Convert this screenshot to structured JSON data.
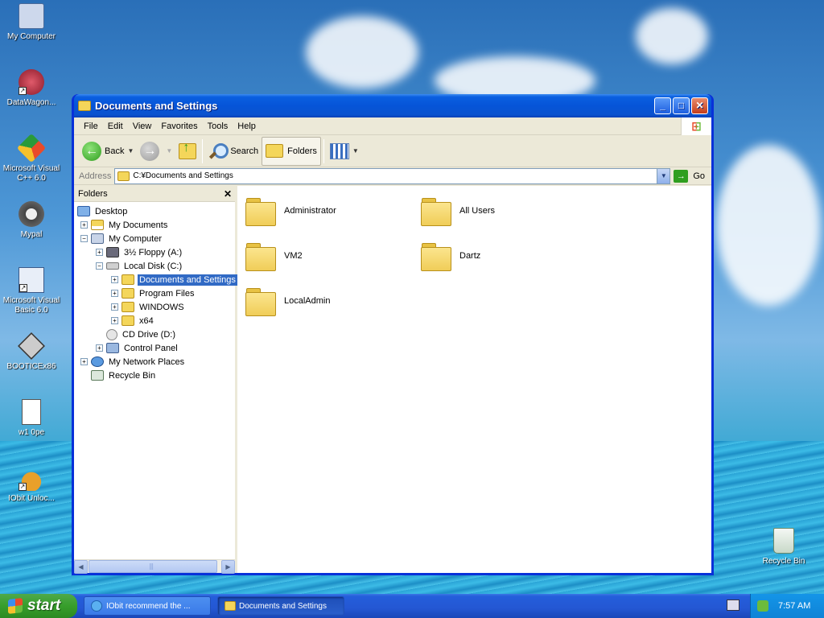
{
  "desktop": {
    "icons": [
      {
        "label": "My Computer",
        "icon": "my-computer-icon"
      },
      {
        "label": "DataWagon...",
        "icon": "datawagon-icon"
      },
      {
        "label": "Microsoft Visual C++ 6.0",
        "icon": "visual-cpp-icon"
      },
      {
        "label": "Mypal",
        "icon": "mypal-icon"
      },
      {
        "label": "Microsoft Visual Basic 6.0",
        "icon": "visual-basic-icon"
      },
      {
        "label": "BOOTICEx86",
        "icon": "bootice-icon"
      },
      {
        "label": "w1 0pe",
        "icon": "document-icon"
      },
      {
        "label": "IObit Unloc...",
        "icon": "iobit-unlocker-icon"
      },
      {
        "label": "Recycle Bin",
        "icon": "recycle-bin-icon"
      }
    ]
  },
  "window": {
    "title": "Documents and Settings",
    "menu": [
      "File",
      "Edit",
      "View",
      "Favorites",
      "Tools",
      "Help"
    ],
    "toolbar": {
      "back": "Back",
      "search": "Search",
      "folders": "Folders"
    },
    "address": {
      "label": "Address",
      "value": "C:¥Documents and Settings",
      "go": "Go"
    },
    "folders_pane": {
      "title": "Folders",
      "tree": [
        {
          "label": "Desktop",
          "expander": "",
          "icon": "desktop-icon"
        },
        {
          "label": "My Documents",
          "expander": "+",
          "icon": "my-documents-icon"
        },
        {
          "label": "My Computer",
          "expander": "−",
          "icon": "my-computer-icon"
        },
        {
          "label": "3½ Floppy (A:)",
          "expander": "+",
          "icon": "floppy-icon"
        },
        {
          "label": "Local Disk (C:)",
          "expander": "−",
          "icon": "local-disk-icon"
        },
        {
          "label": "Documents and Settings",
          "expander": "+",
          "icon": "folder-icon",
          "selected": true
        },
        {
          "label": "Program Files",
          "expander": "+",
          "icon": "folder-icon"
        },
        {
          "label": "WINDOWS",
          "expander": "+",
          "icon": "folder-icon"
        },
        {
          "label": "x64",
          "expander": "+",
          "icon": "folder-icon"
        },
        {
          "label": "CD Drive (D:)",
          "expander": "",
          "icon": "cd-drive-icon"
        },
        {
          "label": "Control Panel",
          "expander": "+",
          "icon": "control-panel-icon"
        },
        {
          "label": "My Network Places",
          "expander": "+",
          "icon": "network-places-icon"
        },
        {
          "label": "Recycle Bin",
          "expander": "",
          "icon": "recycle-bin-icon"
        }
      ]
    },
    "files": [
      "Administrator",
      "All Users",
      "VM2",
      "Dartz",
      "LocalAdmin"
    ]
  },
  "taskbar": {
    "start": "start",
    "tasks": [
      {
        "label": "IObit recommend the ...",
        "icon": "internet-explorer-icon",
        "active": false
      },
      {
        "label": "Documents and Settings",
        "icon": "folder-icon",
        "active": true
      }
    ],
    "clock": "7:57 AM"
  }
}
